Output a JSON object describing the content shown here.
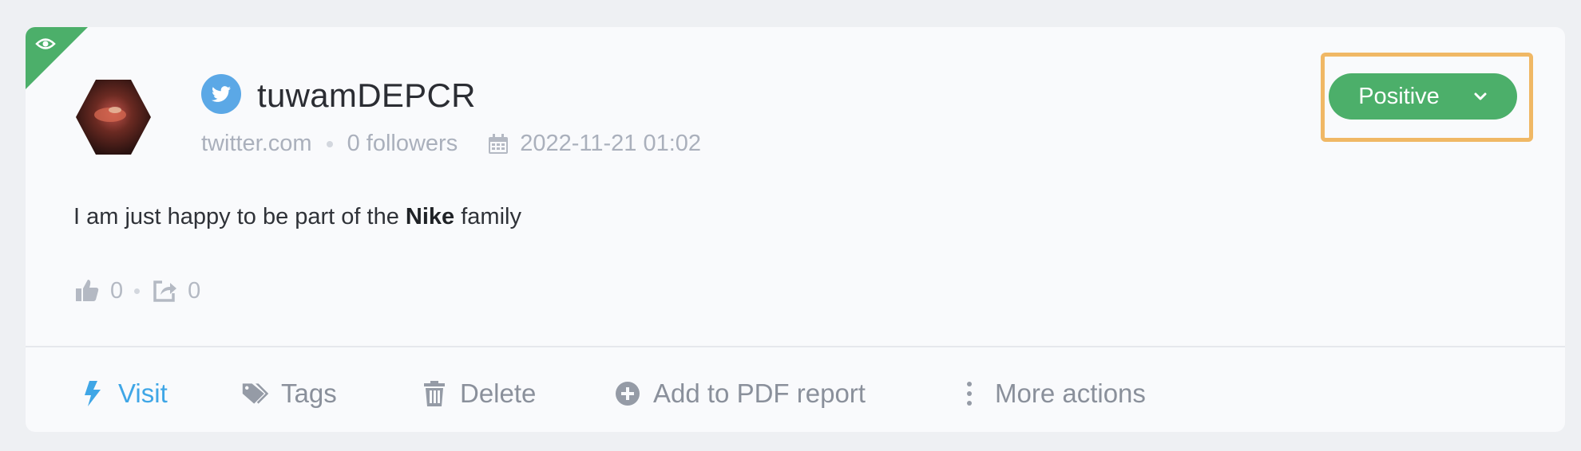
{
  "post": {
    "author": "tuwamDEPCR",
    "source": "twitter.com",
    "followers": "0 followers",
    "date": "2022-11-21 01:02",
    "text_before": "I am just happy to be part of the ",
    "text_bold": "Nike",
    "text_after": " family",
    "likes": "0",
    "shares": "0"
  },
  "sentiment": {
    "label": "Positive",
    "color": "#4caf6a",
    "highlight_color": "#f0b865"
  },
  "actions": {
    "visit": "Visit",
    "tags": "Tags",
    "delete": "Delete",
    "add_pdf": "Add to PDF report",
    "more": "More actions"
  },
  "icons": {
    "corner": "eye-icon",
    "network": "twitter-icon",
    "date": "calendar-icon",
    "likes": "thumbs-up-icon",
    "shares": "share-icon",
    "visit": "bolt-icon",
    "tags": "tags-icon",
    "delete": "trash-icon",
    "add_pdf": "plus-circle-icon",
    "more": "vertical-dots-icon"
  }
}
